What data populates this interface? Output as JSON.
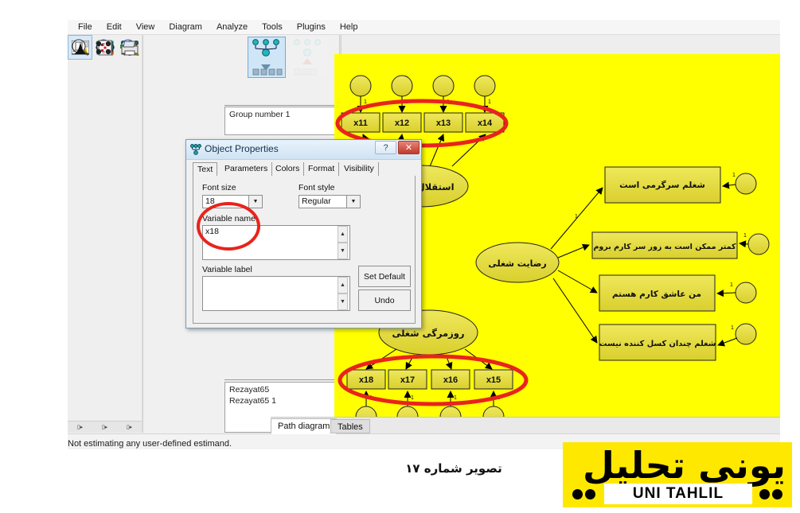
{
  "menu": {
    "items": [
      "File",
      "Edit",
      "View",
      "Diagram",
      "Analyze",
      "Tools",
      "Plugins",
      "Help"
    ]
  },
  "panels": {
    "group_label": "Group number 1",
    "models": [
      "Rezayat65",
      "Rezayat65 1"
    ]
  },
  "tabs": {
    "path_diagram": "Path diagram",
    "tables": "Tables"
  },
  "statusbar": {
    "text": "Not estimating any user-defined estimand."
  },
  "dialog": {
    "title": "Object Properties",
    "help_button": "?",
    "close_button": "✕",
    "tabs": [
      "Text",
      "Parameters",
      "Colors",
      "Format",
      "Visibility"
    ],
    "active_tab": "Text",
    "font_size_label": "Font size",
    "font_size_value": "18",
    "font_style_label": "Font style",
    "font_style_value": "Regular",
    "variable_name_label": "Variable name",
    "variable_name_value": "x18",
    "variable_label_label": "Variable label",
    "variable_label_value": "",
    "set_default_button": "Set Default",
    "undo_button": "Undo"
  },
  "diagram": {
    "latents": [
      {
        "id": "independence",
        "label": "استقلال شغلی"
      },
      {
        "id": "satisfaction",
        "label": "رضایت شغلی"
      },
      {
        "id": "routine",
        "label": "روزمرگی شغلی"
      }
    ],
    "top_indicators": [
      "x11",
      "x12",
      "x13",
      "x14"
    ],
    "bottom_indicators": [
      "x18",
      "x17",
      "x16",
      "x15"
    ],
    "satisfaction_items": [
      "شغلم سرگرمی است",
      "کمتر ممکن است به زور  سر کارم بروم",
      "من عاشق کارم هستم",
      "شغلم چندان کسل کننده نیست"
    ],
    "path_coefficient": "1",
    "canvas_color": "#ffff00",
    "node_fill": "#e8e03c",
    "annotation_color": "#e8241b"
  },
  "caption": {
    "text": "تصویر شماره ۱۷"
  },
  "logo": {
    "persian": "یونی تحلیل",
    "latin": "UNI TAHLIL",
    "background": "#ffe800"
  }
}
